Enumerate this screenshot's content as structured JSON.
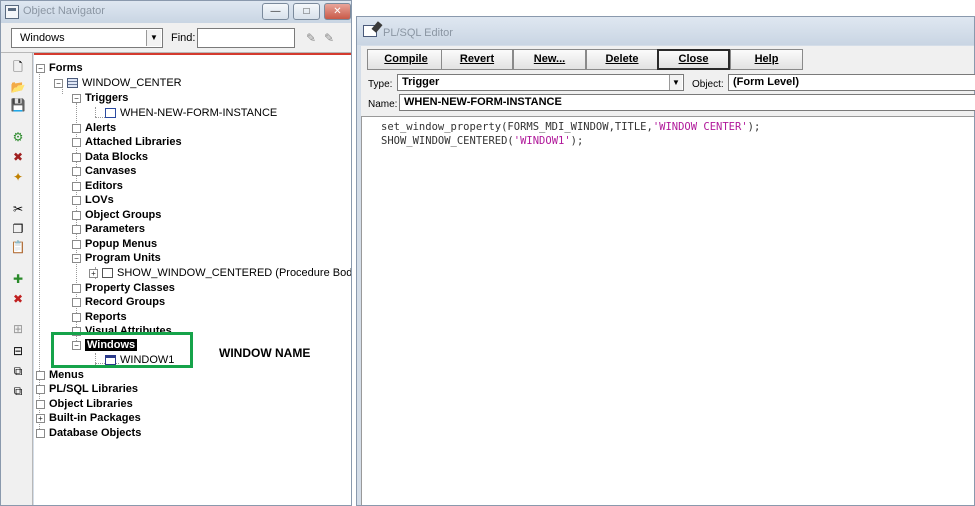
{
  "navigator": {
    "title": "Object Navigator",
    "min_label": "—",
    "max_label": "□",
    "close_label": "✕",
    "selector_value": "Windows",
    "find_label": "Find:",
    "find_value": ""
  },
  "tree": {
    "forms": "Forms",
    "form_name": "WINDOW_CENTER",
    "triggers": "Triggers",
    "trigger_item": "WHEN-NEW-FORM-INSTANCE",
    "alerts": "Alerts",
    "attached_libraries": "Attached Libraries",
    "data_blocks": "Data Blocks",
    "canvases": "Canvases",
    "editors": "Editors",
    "lovs": "LOVs",
    "object_groups": "Object Groups",
    "parameters": "Parameters",
    "popup_menus": "Popup Menus",
    "program_units": "Program Units",
    "program_unit_item": "SHOW_WINDOW_CENTERED (Procedure Body",
    "property_classes": "Property Classes",
    "record_groups": "Record Groups",
    "reports": "Reports",
    "visual_attributes": "Visual Attributes",
    "windows": "Windows",
    "window_item": "WINDOW1",
    "menus": "Menus",
    "plsql_libraries": "PL/SQL Libraries",
    "object_libraries": "Object Libraries",
    "builtin_packages": "Built-in Packages",
    "database_objects": "Database Objects"
  },
  "annotation": {
    "text": "WINDOW NAME",
    "box_color": "#16a34a"
  },
  "editor": {
    "title": "PL/SQL Editor",
    "buttons": {
      "compile": "Compile",
      "revert": "Revert",
      "new": "New...",
      "delete": "Delete",
      "close": "Close",
      "help": "Help"
    },
    "type_label": "Type:",
    "type_value": "Trigger",
    "object_label": "Object:",
    "object_value": "(Form Level)",
    "name_label": "Name:",
    "name_value": "WHEN-NEW-FORM-INSTANCE",
    "code": {
      "line1_pre": "set_window_property(FORMS_MDI_WINDOW,TITLE,",
      "line1_str": "'WINDOW CENTER'",
      "line1_post": ");",
      "line2_pre": "SHOW_WINDOW_CENTERED(",
      "line2_str": "'WINDOW1'",
      "line2_post": ");"
    }
  },
  "colors": {
    "tree_border": "#d43a2e",
    "string_literal": "#b0189a"
  }
}
